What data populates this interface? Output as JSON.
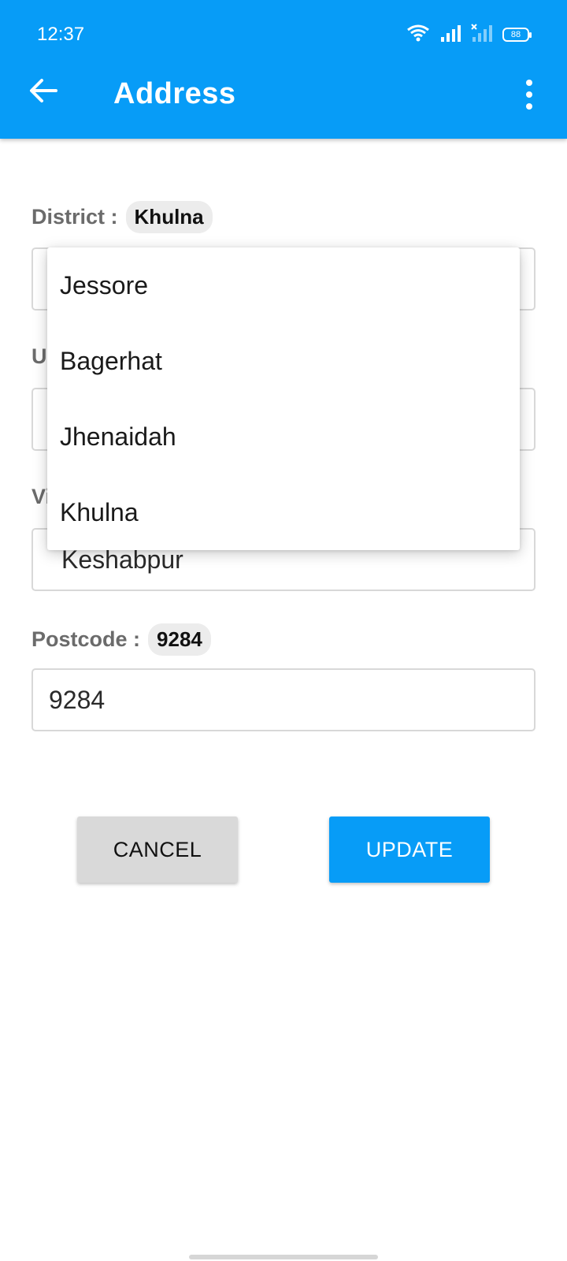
{
  "status_bar": {
    "time": "12:37",
    "battery": "88",
    "icons": [
      "wifi-icon",
      "signal-icon",
      "signal-no-service-icon",
      "battery-icon"
    ]
  },
  "app_bar": {
    "title": "Address",
    "back_icon": "arrow-left-icon",
    "menu_icon": "more-vertical-icon"
  },
  "form": {
    "district": {
      "label": "District :",
      "value_chip": "Khulna"
    },
    "upazila": {
      "label_partial": "U"
    },
    "village": {
      "label_partial": "Vi",
      "value": "Keshabpur"
    },
    "postcode": {
      "label": "Postcode :",
      "value_chip": "9284",
      "input_value": "9284"
    }
  },
  "dropdown": {
    "options": [
      "Jessore",
      "Bagerhat",
      "Jhenaidah",
      "Khulna"
    ]
  },
  "actions": {
    "cancel_label": "CANCEL",
    "update_label": "UPDATE"
  },
  "colors": {
    "primary": "#079cf7",
    "cancel_bg": "#d9d9d9",
    "label_gray": "#6b6b6b"
  }
}
